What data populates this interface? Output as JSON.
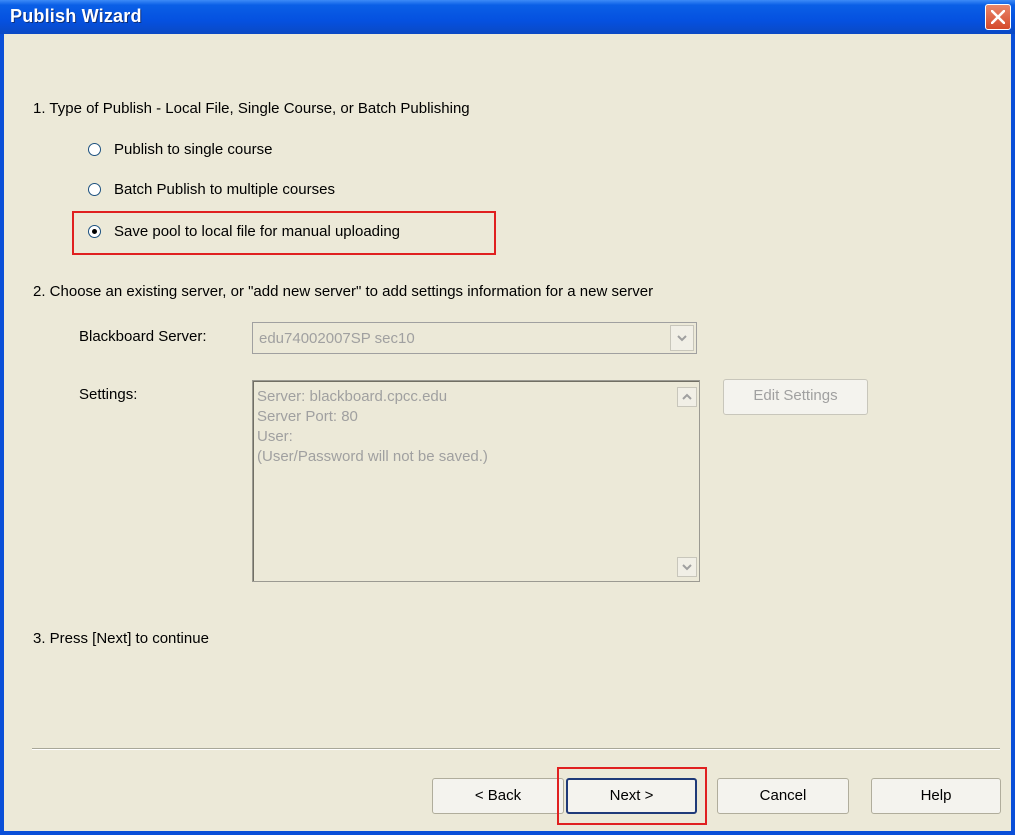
{
  "window": {
    "title": "Publish Wizard"
  },
  "step1": {
    "label": "1.  Type of Publish - Local File, Single Course, or Batch Publishing",
    "options": [
      {
        "label": "Publish to single course",
        "selected": false
      },
      {
        "label": "Batch Publish to multiple courses",
        "selected": false
      },
      {
        "label": "Save pool to local file for manual uploading",
        "selected": true
      }
    ]
  },
  "step2": {
    "label": "2.  Choose an existing server, or \"add new server\" to add settings information for a new server",
    "server_label": "Blackboard Server:",
    "server_value": "edu74002007SP sec10",
    "settings_label": "Settings:",
    "settings_lines": [
      "Server: blackboard.cpcc.edu",
      "Server Port: 80",
      "User:",
      "(User/Password will not be saved.)"
    ],
    "edit_settings_label": "Edit Settings"
  },
  "step3": {
    "label": "3.  Press [Next] to continue"
  },
  "buttons": {
    "back": "< Back",
    "next": "Next >",
    "cancel": "Cancel",
    "help": "Help"
  },
  "colors": {
    "titlebar": "#0551e0",
    "highlight": "#e02020",
    "dialog_bg": "#ece9d8",
    "disabled_text": "#a0a0a0"
  }
}
